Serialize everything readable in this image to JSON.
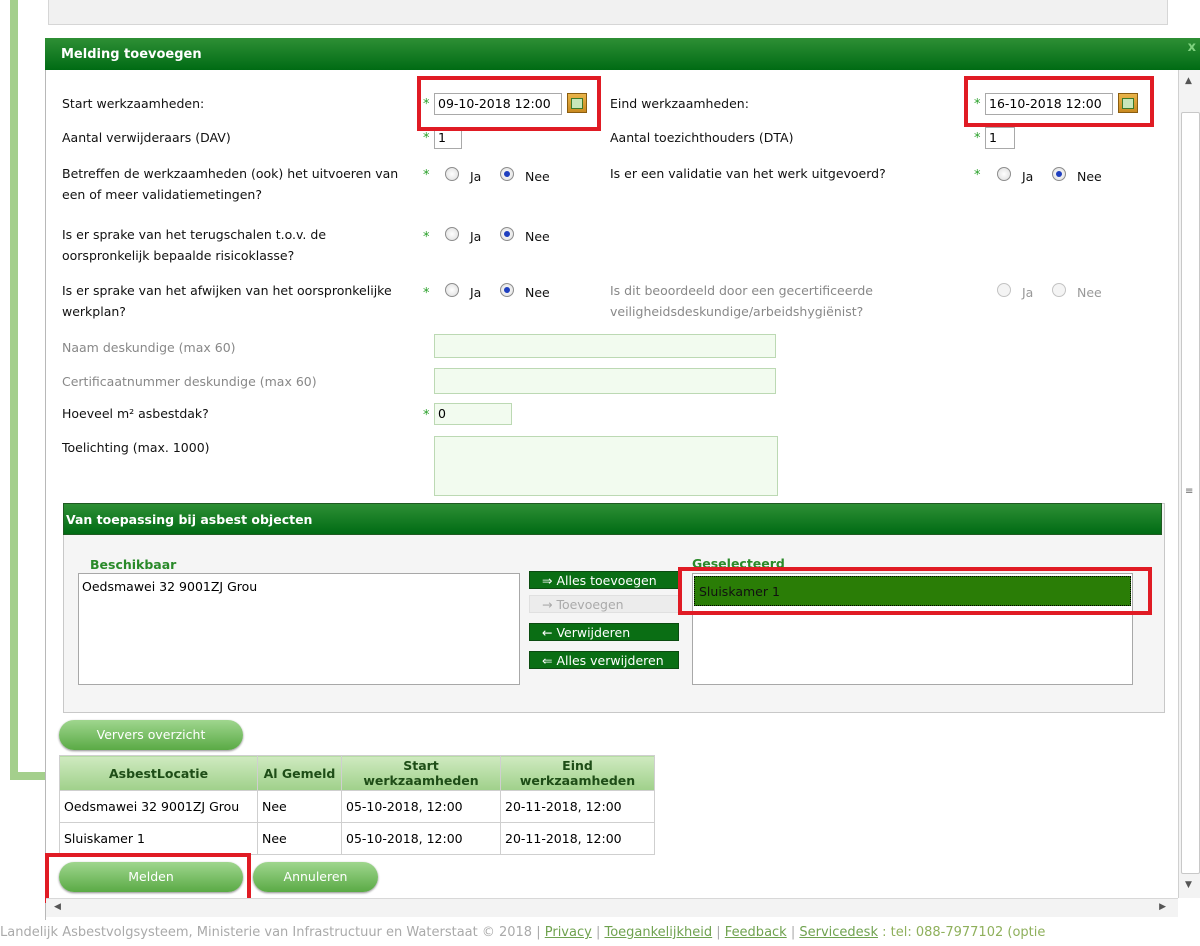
{
  "dialog": {
    "title": "Melding toevoegen",
    "close": "x"
  },
  "form": {
    "start_label": "Start werkzaamheden:",
    "start_value": "09-10-2018 12:00",
    "eind_label": "Eind werkzaamheden:",
    "eind_value": "16-10-2018 12:00",
    "dav_label": "Aantal verwijderaars (DAV)",
    "dav_value": "1",
    "dta_label": "Aantal toezichthouders (DTA)",
    "dta_value": "1",
    "q1_line1": "Betreffen de werkzaamheden (ook) het uitvoeren van",
    "q1_line2": "een of meer validatiemetingen?",
    "q2_label": "Is er een validatie van het werk uitgevoerd?",
    "q3_line1": "Is er sprake van het terugschalen t.o.v. de",
    "q3_line2": "oorspronkelijk bepaalde risicoklasse?",
    "q4_line1": "Is er sprake van het afwijken van het oorspronkelijke",
    "q4_line2": "werkplan?",
    "q5_line1": "Is dit beoordeeld door een gecertificeerde",
    "q5_line2": "veiligheidsdeskundige/arbeidshygiënist?",
    "naam_label": "Naam deskundige (max 60)",
    "cert_label": "Certificaatnummer deskundige (max 60)",
    "m2_label": "Hoeveel m² asbestdak?",
    "m2_value": "0",
    "toel_label": "Toelichting (max. 1000)",
    "ja": "Ja",
    "nee": "Nee",
    "required_mark": "*"
  },
  "objects": {
    "title": "Van toepassing bij asbest objecten",
    "available_label": "Beschikbaar",
    "available_items": [
      "Oedsmawei 32 9001ZJ Grou"
    ],
    "selected_label": "Geselecteerd",
    "selected_items": [
      "Sluiskamer 1"
    ],
    "btn_add_all": "⇒ Alles toevoegen",
    "btn_add": "→ Toevoegen",
    "btn_remove": "← Verwijderen",
    "btn_remove_all": "⇐ Alles verwijderen"
  },
  "overview": {
    "refresh_label": "Ververs overzicht",
    "headers": [
      "AsbestLocatie",
      "Al Gemeld",
      "Start werkzaamheden",
      "Eind werkzaamheden"
    ],
    "rows": [
      [
        "Oedsmawei 32 9001ZJ Grou",
        "Nee",
        "05-10-2018, 12:00",
        "20-11-2018, 12:00"
      ],
      [
        "Sluiskamer 1",
        "Nee",
        "05-10-2018, 12:00",
        "20-11-2018, 12:00"
      ]
    ]
  },
  "actions": {
    "melden": "Melden",
    "annuleren": "Annuleren"
  },
  "footer": {
    "text": "Landelijk Asbestvolgsysteem, Ministerie van Infrastructuur en Waterstaat © 2018 | ",
    "privacy": "Privacy",
    "sep": " | ",
    "toegankelijkheid": "Toegankelijkheid",
    "feedback": "Feedback",
    "servicedesk": "Servicedesk",
    "tail": " : tel: 088-7977102 (optie"
  },
  "colors": {
    "header_green": "#006b14",
    "accent_light_green": "#a4cf8c",
    "highlight_red": "#e01b24",
    "selected_bg": "#2a7d06"
  }
}
